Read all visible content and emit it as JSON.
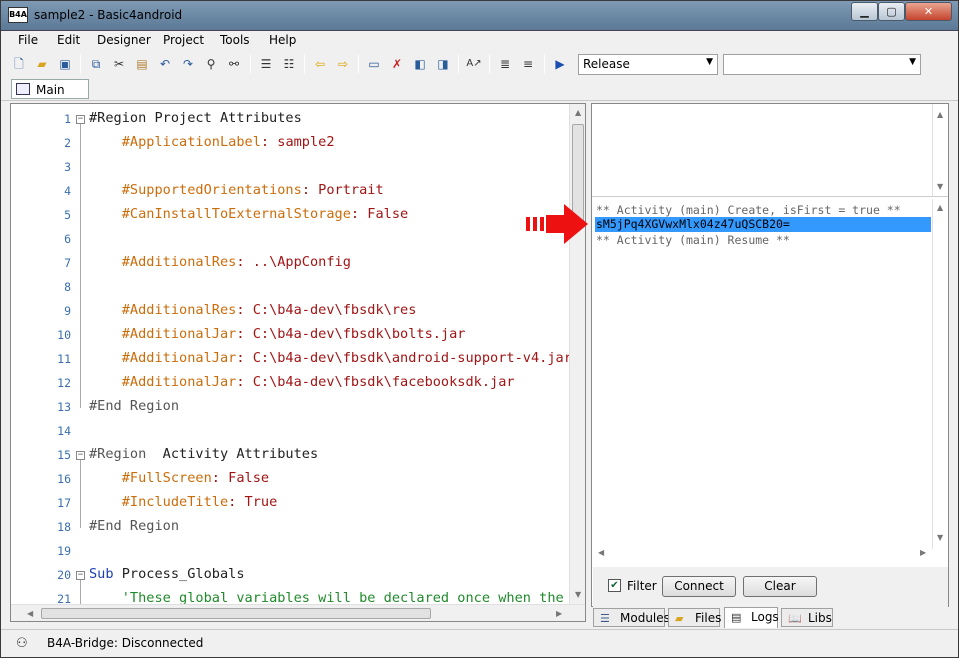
{
  "window": {
    "title": "sample2 - Basic4android",
    "app_icon_text": "B4A"
  },
  "menu": [
    "File",
    "Edit",
    "Designer",
    "Project",
    "Tools",
    "Help"
  ],
  "toolbar": {
    "build_mode": "Release",
    "device_combo": "",
    "icons": [
      "new-file-icon",
      "open-folder-icon",
      "save-icon",
      "copy-icon",
      "cut-icon",
      "paste-icon",
      "undo-icon",
      "redo-icon",
      "find-icon",
      "find-replace-icon",
      "comment-icon",
      "uncomment-icon",
      "back-icon",
      "forward-icon",
      "bookmark-icon",
      "remove-bookmark-icon",
      "prev-bookmark-icon",
      "next-bookmark-icon",
      "font-icon",
      "indent-icon",
      "outdent-icon",
      "run-icon"
    ]
  },
  "tabs": {
    "main": "Main"
  },
  "code": [
    {
      "n": "1",
      "parts": [
        [
          "#Region ",
          "dark"
        ],
        [
          "Project Attributes",
          "dark"
        ]
      ]
    },
    {
      "n": "2",
      "parts": [
        [
          "    ",
          "dark"
        ],
        [
          "#ApplicationLabel",
          "dir"
        ],
        [
          ": sample2",
          "red"
        ]
      ]
    },
    {
      "n": "3",
      "parts": []
    },
    {
      "n": "4",
      "parts": [
        [
          "    ",
          "dark"
        ],
        [
          "#SupportedOrientations",
          "dir"
        ],
        [
          ": Portrait",
          "red"
        ]
      ]
    },
    {
      "n": "5",
      "parts": [
        [
          "    ",
          "dark"
        ],
        [
          "#CanInstallToExternalStorage",
          "dir"
        ],
        [
          ": False",
          "red"
        ]
      ]
    },
    {
      "n": "6",
      "parts": []
    },
    {
      "n": "7",
      "parts": [
        [
          "    ",
          "dark"
        ],
        [
          "#AdditionalRes",
          "dir"
        ],
        [
          ": ..\\AppConfig",
          "red"
        ]
      ]
    },
    {
      "n": "8",
      "parts": []
    },
    {
      "n": "9",
      "parts": [
        [
          "    ",
          "dark"
        ],
        [
          "#AdditionalRes",
          "dir"
        ],
        [
          ": C:\\b4a-dev\\fbsdk\\res",
          "red"
        ]
      ]
    },
    {
      "n": "10",
      "parts": [
        [
          "    ",
          "dark"
        ],
        [
          "#AdditionalJar",
          "dir"
        ],
        [
          ": C:\\b4a-dev\\fbsdk\\bolts.jar",
          "red"
        ]
      ]
    },
    {
      "n": "11",
      "parts": [
        [
          "    ",
          "dark"
        ],
        [
          "#AdditionalJar",
          "dir"
        ],
        [
          ": C:\\b4a-dev\\fbsdk\\android-support-v4.jar",
          "red"
        ]
      ]
    },
    {
      "n": "12",
      "parts": [
        [
          "    ",
          "dark"
        ],
        [
          "#AdditionalJar",
          "dir"
        ],
        [
          ": C:\\b4a-dev\\fbsdk\\facebooksdk.jar",
          "red"
        ]
      ]
    },
    {
      "n": "13",
      "parts": [
        [
          "#End Region",
          "gray"
        ]
      ]
    },
    {
      "n": "14",
      "parts": []
    },
    {
      "n": "15",
      "parts": [
        [
          "#Region ",
          "gray"
        ],
        [
          " Activity Attributes",
          "dark"
        ]
      ]
    },
    {
      "n": "16",
      "parts": [
        [
          "    ",
          "dark"
        ],
        [
          "#FullScreen",
          "dir"
        ],
        [
          ": False",
          "red"
        ]
      ]
    },
    {
      "n": "17",
      "parts": [
        [
          "    ",
          "dark"
        ],
        [
          "#IncludeTitle",
          "dir"
        ],
        [
          ": True",
          "red"
        ]
      ]
    },
    {
      "n": "18",
      "parts": [
        [
          "#End Region",
          "gray"
        ]
      ]
    },
    {
      "n": "19",
      "parts": []
    },
    {
      "n": "20",
      "parts": [
        [
          "Sub ",
          "blue"
        ],
        [
          "Process_Globals",
          "dark"
        ]
      ]
    },
    {
      "n": "21",
      "parts": [
        [
          "    ",
          "dark"
        ],
        [
          "'These global variables will be declared once when the a",
          "green"
        ]
      ]
    }
  ],
  "logs": {
    "lines": [
      "** Activity (main) Create, isFirst = true **",
      "sM5jPq4XGVwxMlx04z47uQSCB20=",
      "** Activity (main) Resume **"
    ],
    "selected_index": 1
  },
  "filter": {
    "label": "Filter",
    "checked": true
  },
  "buttons": {
    "connect": "Connect",
    "clear": "Clear"
  },
  "bottom_tabs": [
    "Modules",
    "Files",
    "Logs",
    "Libs"
  ],
  "active_bottom_tab": "Logs",
  "status": {
    "text": "B4A-Bridge: Disconnected"
  },
  "colors": {
    "directive": "#cc6d0c",
    "string": "#a31515",
    "keyword": "#1c3fb5",
    "comment": "#1f8b2a",
    "selection": "#3399ff",
    "annotation_arrow": "#ee1111"
  }
}
